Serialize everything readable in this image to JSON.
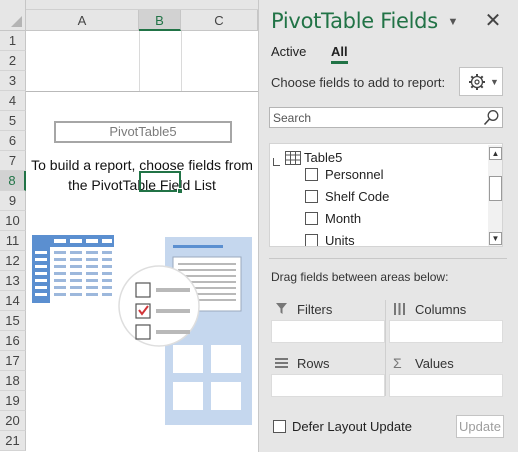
{
  "sheet": {
    "columns": [
      "A",
      "B",
      "C"
    ],
    "rows": [
      "1",
      "2",
      "3",
      "4",
      "5",
      "6",
      "7",
      "8",
      "9",
      "10",
      "11",
      "12",
      "13",
      "14",
      "15",
      "16",
      "17",
      "18",
      "19",
      "20",
      "21"
    ],
    "selected_column": "B",
    "selected_row": "8",
    "pivot_name": "PivotTable5",
    "instruction_line1": "To build a report, choose fields from",
    "instruction_line2": "the PivotTable Field List"
  },
  "pane": {
    "title": "PivotTable Fields",
    "tabs": [
      {
        "label": "Active",
        "active": false
      },
      {
        "label": "All",
        "active": true
      }
    ],
    "choose_label": "Choose fields to add to report:",
    "search_placeholder": "Search",
    "table_name": "Table5",
    "fields": [
      {
        "label": "Personnel",
        "checked": false
      },
      {
        "label": "Shelf Code",
        "checked": false
      },
      {
        "label": "Month",
        "checked": false
      },
      {
        "label": "Units",
        "checked": false
      }
    ],
    "drag_label": "Drag fields between areas below:",
    "areas": {
      "filters": "Filters",
      "columns": "Columns",
      "rows": "Rows",
      "values": "Values"
    },
    "defer_label": "Defer Layout Update",
    "update_label": "Update"
  },
  "colors": {
    "accent": "#217346",
    "pane_bg": "#e6e6e6",
    "illustration_blue": "#5b8fd0",
    "illustration_light": "#c5d7ee"
  },
  "icons": [
    "corner-select-icon",
    "dropdown-arrow-icon",
    "close-icon",
    "gear-icon",
    "search-icon",
    "table-icon",
    "filter-icon",
    "columns-icon",
    "rows-icon",
    "sigma-icon"
  ]
}
